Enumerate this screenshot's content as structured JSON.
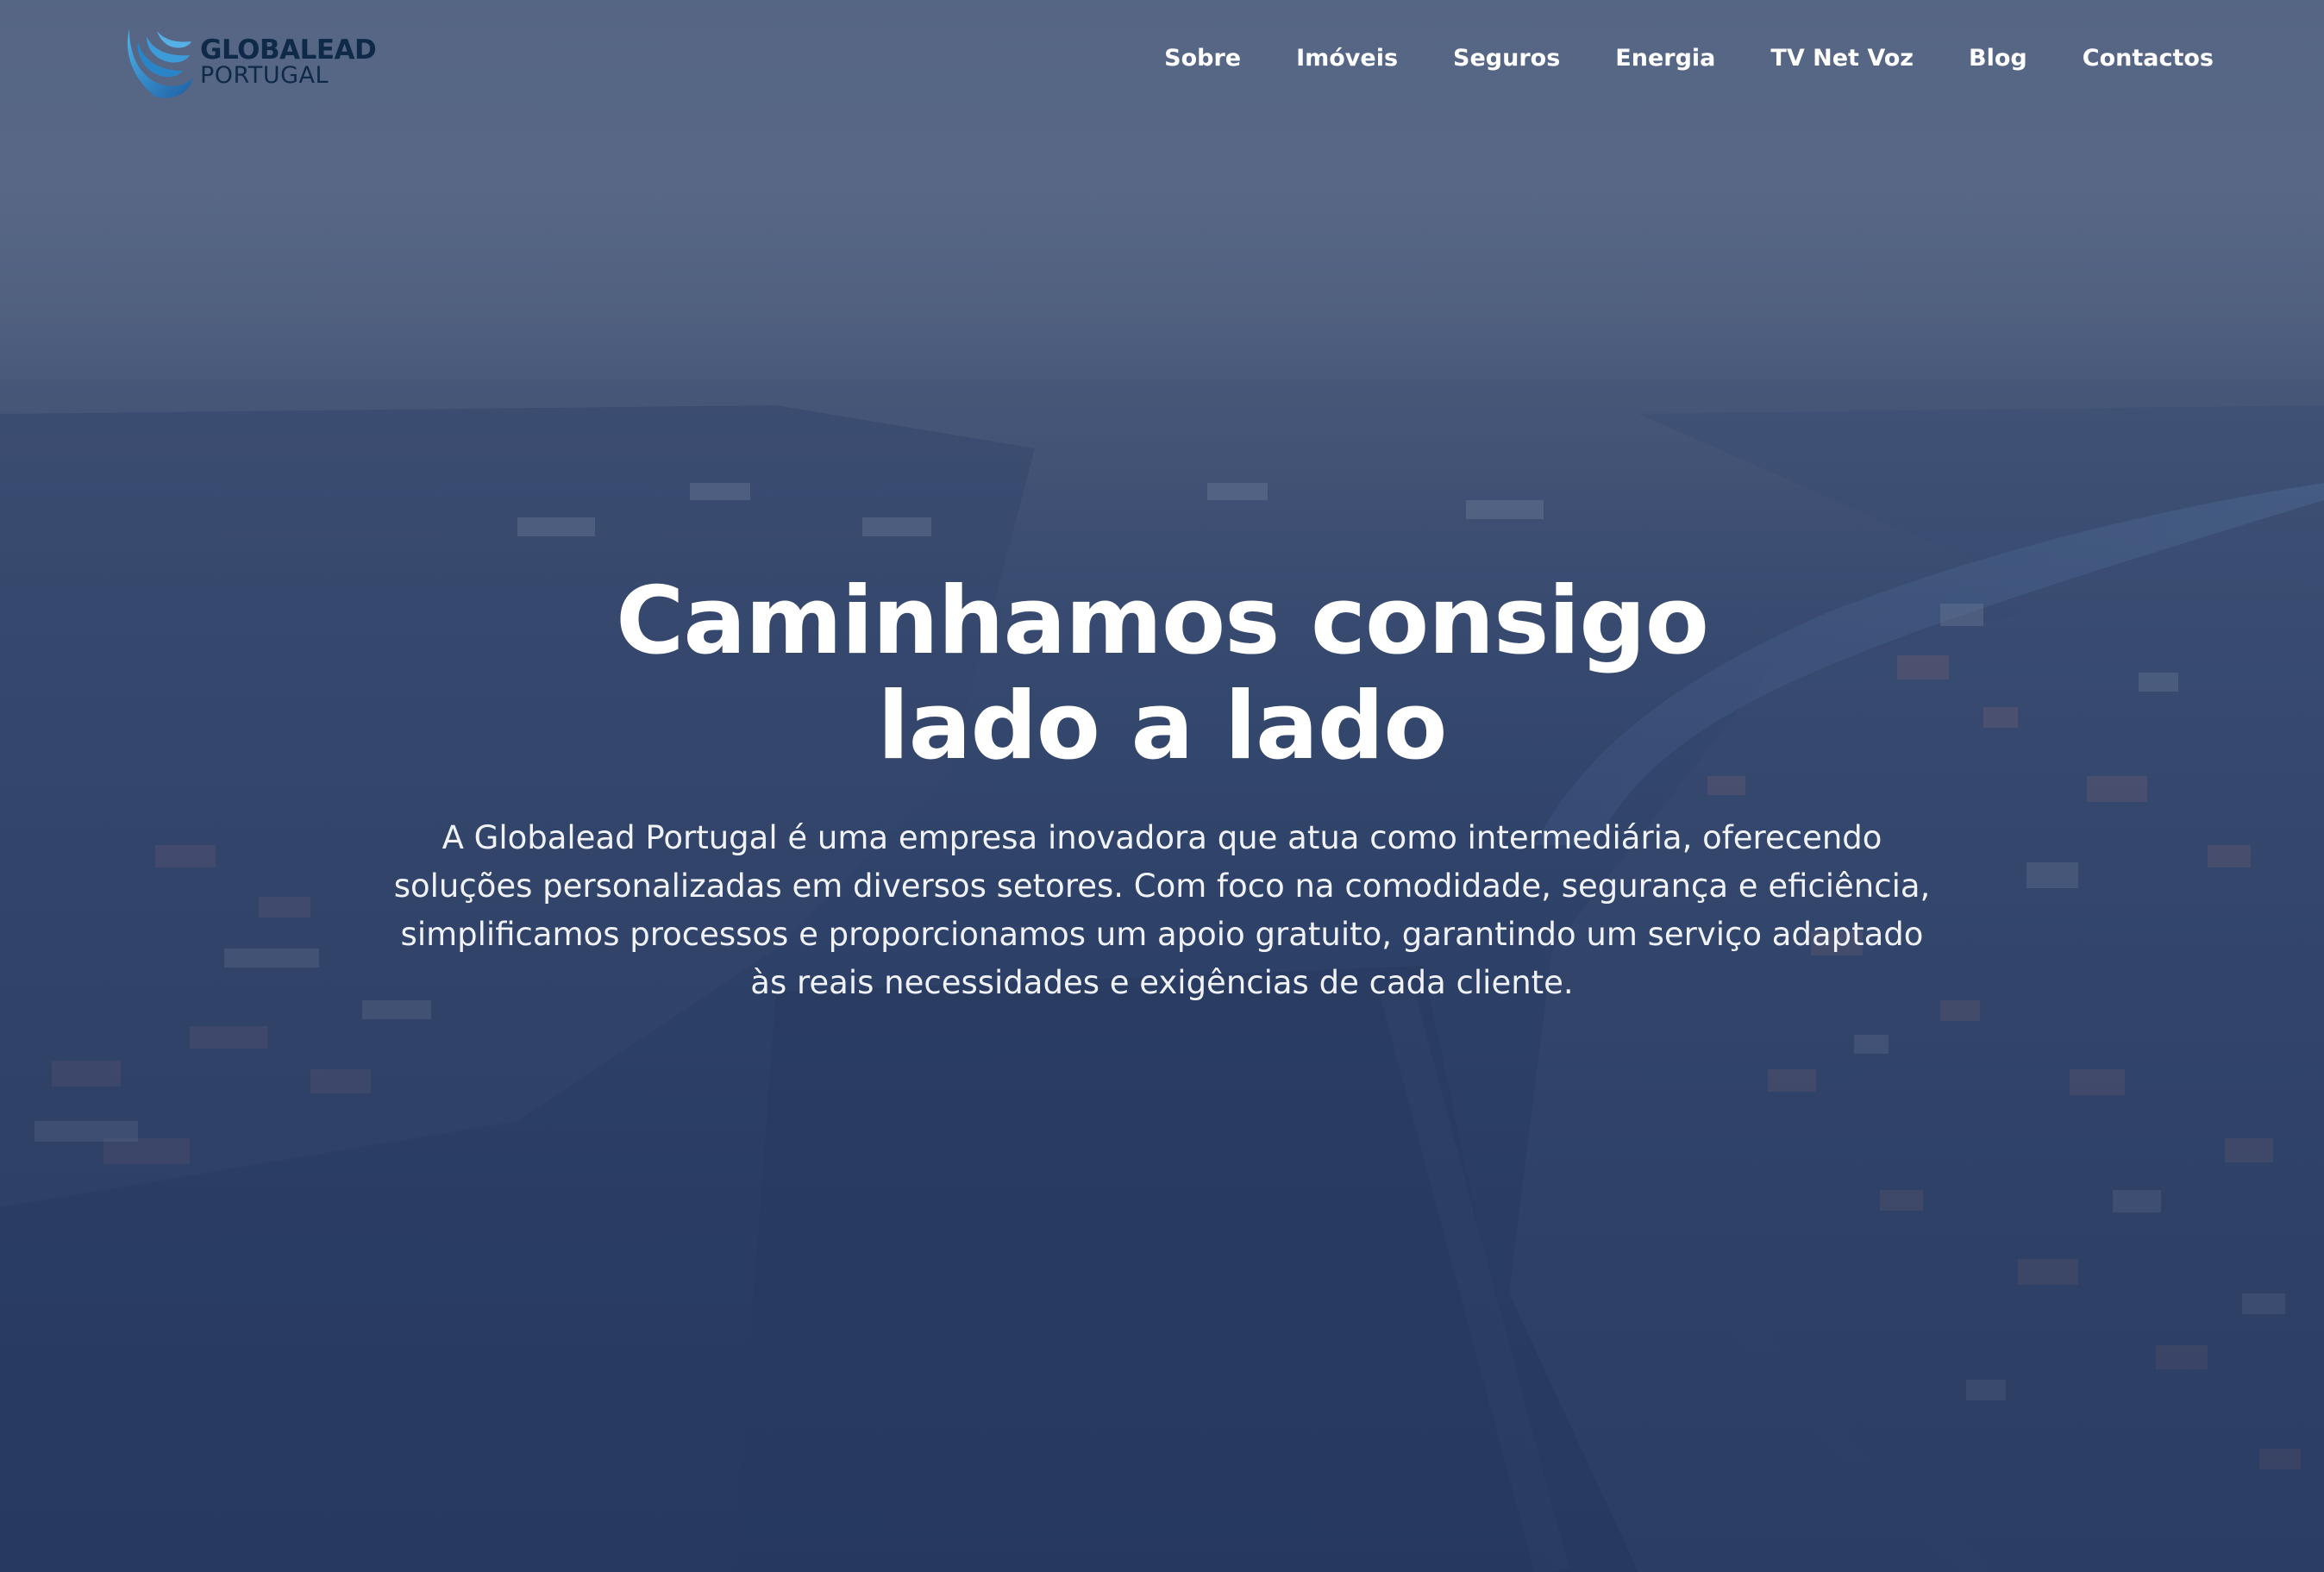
{
  "brand": {
    "name_line1": "GLOBALEAD",
    "name_line2": "PORTUGAL",
    "logo_icon": "globe-wave-logo-icon"
  },
  "nav": {
    "items": [
      {
        "label": "Sobre"
      },
      {
        "label": "Imóveis"
      },
      {
        "label": "Seguros"
      },
      {
        "label": "Energia"
      },
      {
        "label": "TV Net Voz"
      },
      {
        "label": "Blog"
      },
      {
        "label": "Contactos"
      }
    ]
  },
  "hero": {
    "title_line1": "Caminhamos consigo",
    "title_line2": "lado a lado",
    "description": "A Globalead Portugal é uma empresa inovadora que atua como intermediária, oferecendo soluções personalizadas em diversos setores. Com foco na comodidade, segurança e eficiência, simplificamos processos e proporcionamos um apoio gratuito, garantindo um serviço adaptado às reais necessidades e exigências de cada cliente."
  },
  "colors": {
    "overlay": "#2d4168",
    "logo_text": "#0f2a48",
    "logo_accent": "#2a8ad0",
    "text": "#ffffff"
  }
}
